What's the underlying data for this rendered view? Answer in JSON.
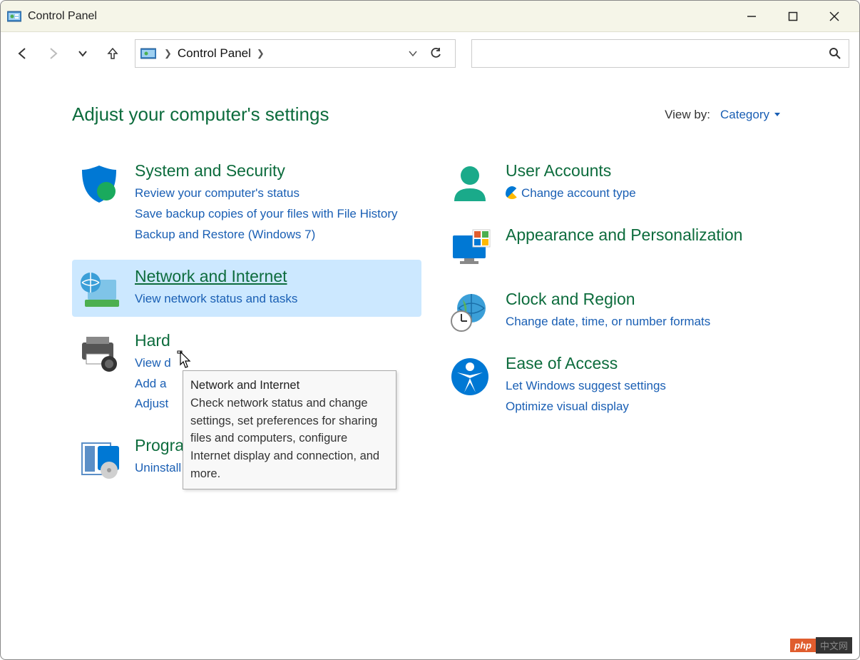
{
  "window": {
    "title": "Control Panel"
  },
  "address": {
    "crumb": "Control Panel"
  },
  "header": {
    "title": "Adjust your computer's settings",
    "viewby_label": "View by:",
    "viewby_value": "Category"
  },
  "left": [
    {
      "title": "System and Security",
      "subs": [
        "Review your computer's status",
        "Save backup copies of your files with File History",
        "Backup and Restore (Windows 7)"
      ]
    },
    {
      "title": "Network and Internet",
      "subs": [
        "View network status and tasks"
      ]
    },
    {
      "title": "Hardware and Sound",
      "subs_partial": [
        "View d",
        "Add a",
        "Adjust"
      ]
    },
    {
      "title": "Programs",
      "subs": [
        "Uninstall a program"
      ]
    }
  ],
  "right": [
    {
      "title": "User Accounts",
      "subs": [
        "Change account type"
      ],
      "shield": true
    },
    {
      "title": "Appearance and Personalization",
      "subs": []
    },
    {
      "title": "Clock and Region",
      "subs": [
        "Change date, time, or number formats"
      ]
    },
    {
      "title": "Ease of Access",
      "subs": [
        "Let Windows suggest settings",
        "Optimize visual display"
      ]
    }
  ],
  "tooltip": {
    "title": "Network and Internet",
    "body": "Check network status and change settings, set preferences for sharing files and computers, configure Internet display and connection, and more."
  },
  "watermark": {
    "a": "php",
    "b": "中文网"
  }
}
